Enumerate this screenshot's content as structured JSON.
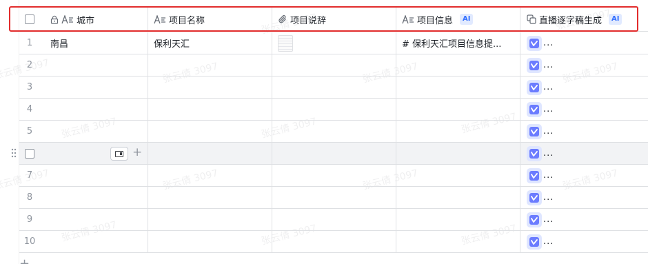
{
  "columns": {
    "city": {
      "label": "城市",
      "locked": true,
      "icon": "text-field-icon"
    },
    "name": {
      "label": "项目名称",
      "icon": "text-field-icon"
    },
    "desc": {
      "label": "项目说辞",
      "icon": "attachment-icon"
    },
    "info": {
      "label": "项目信息",
      "icon": "text-field-icon",
      "badge": "AI"
    },
    "live": {
      "label": "直播逐字稿生成",
      "icon": "copy-icon",
      "badge": "AI"
    }
  },
  "rows": [
    {
      "index": "1",
      "city": "南昌",
      "name": "保利天汇",
      "has_attachment": true,
      "info": "# 保利天汇项目信息提...",
      "live": "..."
    },
    {
      "index": "2",
      "city": "",
      "name": "",
      "has_attachment": false,
      "info": "",
      "live": "..."
    },
    {
      "index": "3",
      "city": "",
      "name": "",
      "has_attachment": false,
      "info": "",
      "live": "..."
    },
    {
      "index": "4",
      "city": "",
      "name": "",
      "has_attachment": false,
      "info": "",
      "live": "..."
    },
    {
      "index": "5",
      "city": "",
      "name": "",
      "has_attachment": false,
      "info": "",
      "live": "..."
    },
    {
      "index": "",
      "city": "",
      "name": "",
      "has_attachment": false,
      "info": "",
      "live": "...",
      "hovered": true
    },
    {
      "index": "7",
      "city": "",
      "name": "",
      "has_attachment": false,
      "info": "",
      "live": "..."
    },
    {
      "index": "8",
      "city": "",
      "name": "",
      "has_attachment": false,
      "info": "",
      "live": "..."
    },
    {
      "index": "9",
      "city": "",
      "name": "",
      "has_attachment": false,
      "info": "",
      "live": "..."
    },
    {
      "index": "10",
      "city": "",
      "name": "",
      "has_attachment": false,
      "info": "",
      "live": "..."
    }
  ],
  "add_row_label": "+",
  "row_add_button_label": "+",
  "watermark_text": "张云倩 3097",
  "colors": {
    "accent": "#3370ff",
    "highlight_border": "#e22c2c",
    "ai_chip": "#6b7cff"
  }
}
